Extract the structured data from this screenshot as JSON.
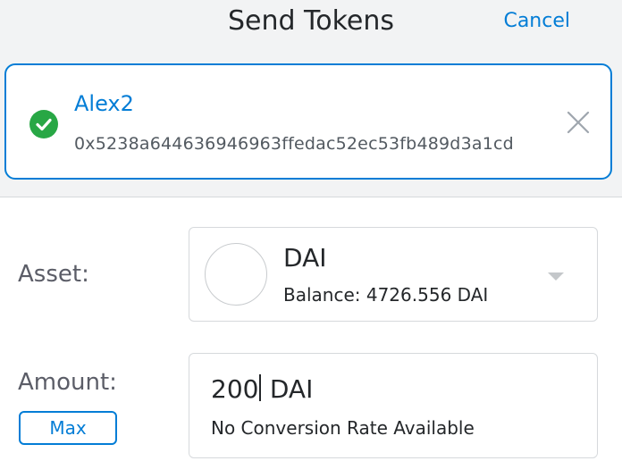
{
  "header": {
    "title": "Send Tokens",
    "cancel_label": "Cancel"
  },
  "recipient": {
    "name": "Alex2",
    "address": "0x5238a644636946963ffedac52ec53fb489d3a1cd",
    "status_icon": "check-circle-icon",
    "clear_icon": "close-icon"
  },
  "asset": {
    "label": "Asset:",
    "symbol": "DAI",
    "balance_text": "Balance: 4726.556 DAI",
    "dropdown_icon": "caret-down-icon"
  },
  "amount": {
    "label": "Amount:",
    "value": "200",
    "unit": "DAI",
    "conversion_text": "No Conversion Rate Available",
    "max_label": "Max"
  },
  "colors": {
    "accent": "#037dd6",
    "success": "#28a745",
    "background": "#f2f3f4"
  }
}
